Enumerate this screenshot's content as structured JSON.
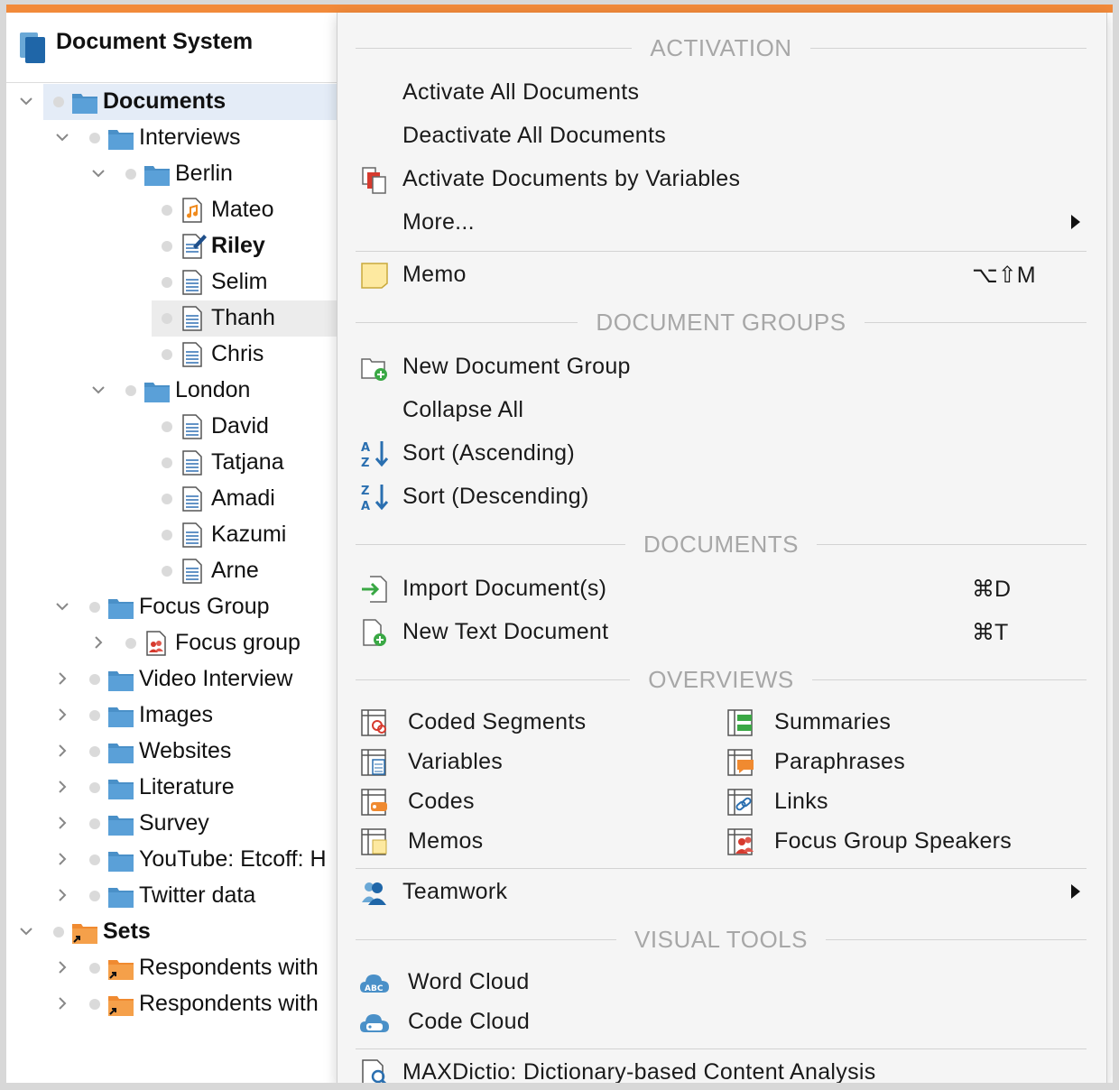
{
  "panel": {
    "title": "Document System"
  },
  "tree": [
    {
      "label": "Documents",
      "bold": true
    },
    {
      "label": "Interviews"
    },
    {
      "label": "Berlin"
    },
    {
      "label": "Mateo"
    },
    {
      "label": "Riley",
      "bold": true
    },
    {
      "label": "Selim"
    },
    {
      "label": "Thanh"
    },
    {
      "label": "Chris"
    },
    {
      "label": "London"
    },
    {
      "label": "David"
    },
    {
      "label": "Tatjana"
    },
    {
      "label": "Amadi"
    },
    {
      "label": "Kazumi"
    },
    {
      "label": "Arne"
    },
    {
      "label": "Focus Group"
    },
    {
      "label": "Focus group"
    },
    {
      "label": "Video Interview"
    },
    {
      "label": "Images"
    },
    {
      "label": "Websites"
    },
    {
      "label": "Literature"
    },
    {
      "label": "Survey"
    },
    {
      "label": "YouTube: Etcoff: H"
    },
    {
      "label": "Twitter data"
    },
    {
      "label": "Sets",
      "bold": true
    },
    {
      "label": "Respondents with"
    },
    {
      "label": "Respondents with"
    }
  ],
  "menu": {
    "activation": {
      "header": "ACTIVATION",
      "activate_all": "Activate All Documents",
      "deactivate_all": "Deactivate All Documents",
      "activate_by_vars": "Activate Documents by Variables",
      "more": "More..."
    },
    "memo": {
      "label": "Memo",
      "shortcut": "⌥⇧M"
    },
    "document_groups": {
      "header": "DOCUMENT GROUPS",
      "new_group": "New Document Group",
      "collapse_all": "Collapse All",
      "sort_asc": "Sort (Ascending)",
      "sort_desc": "Sort (Descending)"
    },
    "documents": {
      "header": "DOCUMENTS",
      "import": "Import Document(s)",
      "import_shortcut": "⌘D",
      "new_text": "New Text Document",
      "new_text_shortcut": "⌘T"
    },
    "overviews": {
      "header": "OVERVIEWS",
      "coded_segments": "Coded Segments",
      "variables": "Variables",
      "codes": "Codes",
      "memos": "Memos",
      "summaries": "Summaries",
      "paraphrases": "Paraphrases",
      "links": "Links",
      "speakers": "Focus Group Speakers"
    },
    "teamwork": "Teamwork",
    "visual_tools": {
      "header": "VISUAL TOOLS",
      "word_cloud": "Word Cloud",
      "code_cloud": "Code Cloud"
    },
    "maxdictio": "MAXDictio: Dictionary-based Content Analysis"
  },
  "colors": {
    "accent_bar": "#f28a3a",
    "folder_blue": "#4a90c8",
    "set_orange": "#f5a04a",
    "selection": "#e4ecf7"
  }
}
